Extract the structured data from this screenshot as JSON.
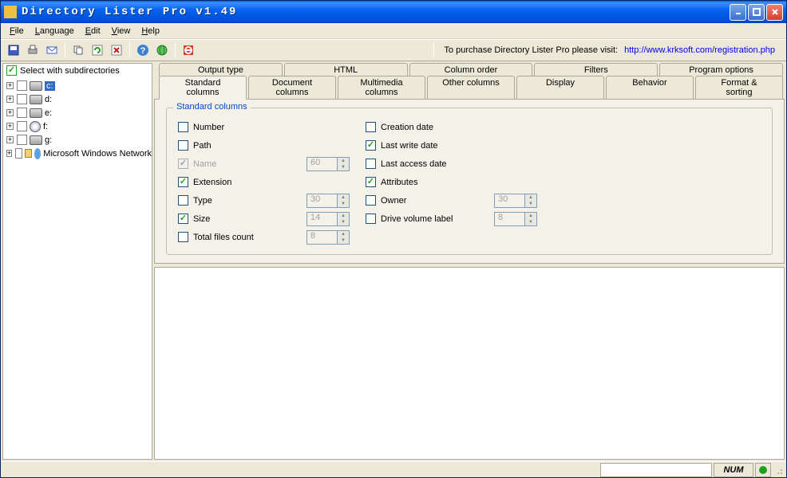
{
  "window": {
    "title": "Directory Lister Pro v1.49"
  },
  "menu": {
    "file": "File",
    "language": "Language",
    "edit": "Edit",
    "view": "View",
    "help": "Help"
  },
  "toolbar": {
    "purchase_text": "To purchase Directory Lister Pro please visit:",
    "purchase_link": "http://www.krksoft.com/registration.php"
  },
  "tree": {
    "header": "Select with subdirectories",
    "items": [
      {
        "label": "c:",
        "icon": "drive",
        "selected": true
      },
      {
        "label": "d:",
        "icon": "drive"
      },
      {
        "label": "e:",
        "icon": "drive"
      },
      {
        "label": "f:",
        "icon": "cd"
      },
      {
        "label": "g:",
        "icon": "drive"
      },
      {
        "label": "Microsoft Windows Network",
        "icon": "net",
        "noexpand": false
      }
    ]
  },
  "tabs": {
    "row1": [
      "Output type",
      "HTML",
      "Column order",
      "Filters",
      "Program options"
    ],
    "row2": [
      "Standard columns",
      "Document columns",
      "Multimedia columns",
      "Other columns",
      "Display",
      "Behavior",
      "Format & sorting"
    ],
    "active": "Standard columns"
  },
  "standard_columns": {
    "legend": "Standard columns",
    "left": [
      {
        "label": "Number",
        "checked": false
      },
      {
        "label": "Path",
        "checked": false
      },
      {
        "label": "Name",
        "checked": true,
        "disabled": true,
        "spinner": "60"
      },
      {
        "label": "Extension",
        "checked": true
      },
      {
        "label": "Type",
        "checked": false,
        "spinner": "30"
      },
      {
        "label": "Size",
        "checked": true,
        "spinner": "14"
      },
      {
        "label": "Total files count",
        "checked": false,
        "spinner": "8"
      }
    ],
    "right": [
      {
        "label": "Creation date",
        "checked": false
      },
      {
        "label": "Last write date",
        "checked": true
      },
      {
        "label": "Last access date",
        "checked": false
      },
      {
        "label": "Attributes",
        "checked": true
      },
      {
        "label": "Owner",
        "checked": false,
        "spinner": "30"
      },
      {
        "label": "Drive volume label",
        "checked": false,
        "spinner": "8"
      }
    ]
  },
  "status": {
    "num": "NUM"
  }
}
